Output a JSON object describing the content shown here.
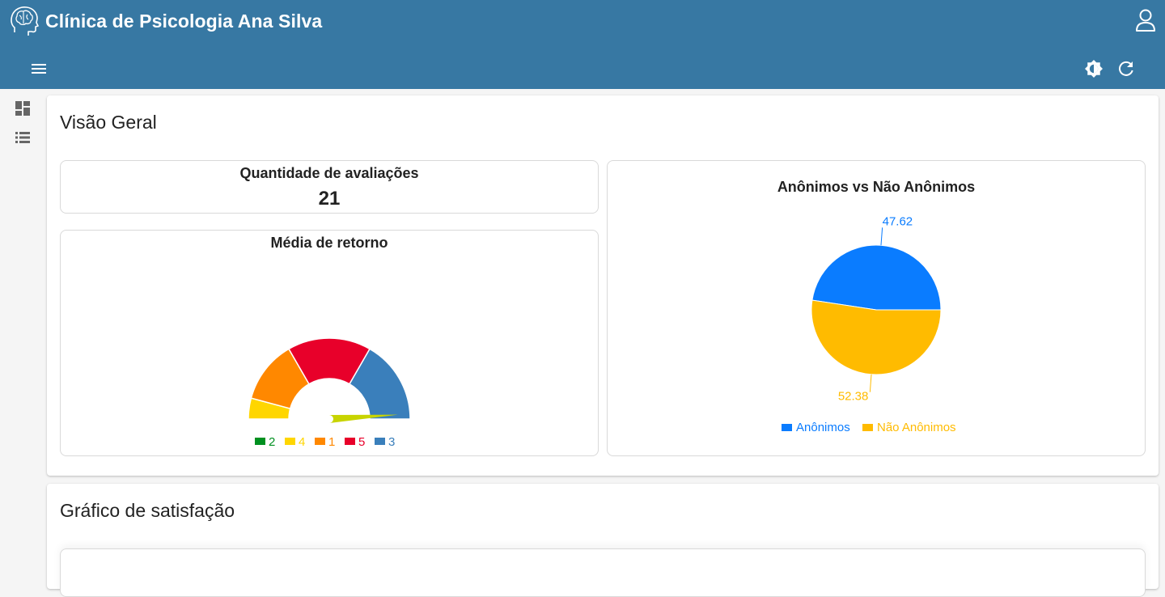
{
  "app": {
    "title": "Clínica de Psicologia Ana Silva"
  },
  "icons": {
    "brand": "brain-head-icon",
    "user": "user-icon",
    "menu": "menu-icon",
    "theme": "brightness-icon",
    "refresh": "refresh-icon",
    "nav_dashboard": "dashboard-icon",
    "nav_list": "list-icon"
  },
  "colors": {
    "header": "#3778a3",
    "blue": "#0a7cff",
    "amber": "#ffbb00"
  },
  "overview": {
    "title": "Visão Geral",
    "count_card": {
      "label": "Quantidade de avaliações",
      "value": "21"
    },
    "gauge_card": {
      "title": "Média de retorno"
    }
  },
  "satisfaction": {
    "title": "Gráfico de satisfação"
  },
  "chart_data": [
    {
      "type": "pie",
      "title": "Média de retorno",
      "variant": "semicircle-gauge",
      "categories": [
        "2",
        "4",
        "1",
        "5",
        "3"
      ],
      "values": [
        0,
        1,
        3,
        4,
        4
      ],
      "colors": [
        "#009020",
        "#ffd600",
        "#ff8800",
        "#e8002a",
        "#3a7fbb"
      ],
      "needle_fraction": 0.98,
      "legend_position": "bottom"
    },
    {
      "type": "pie",
      "title": "Anônimos vs Não Anônimos",
      "categories": [
        "Anônimos",
        "Não Anônimos"
      ],
      "values": [
        47.62,
        52.38
      ],
      "labels": [
        "47.62",
        "52.38"
      ],
      "colors": [
        "#0a7cff",
        "#ffbb00"
      ],
      "legend_position": "bottom"
    }
  ]
}
